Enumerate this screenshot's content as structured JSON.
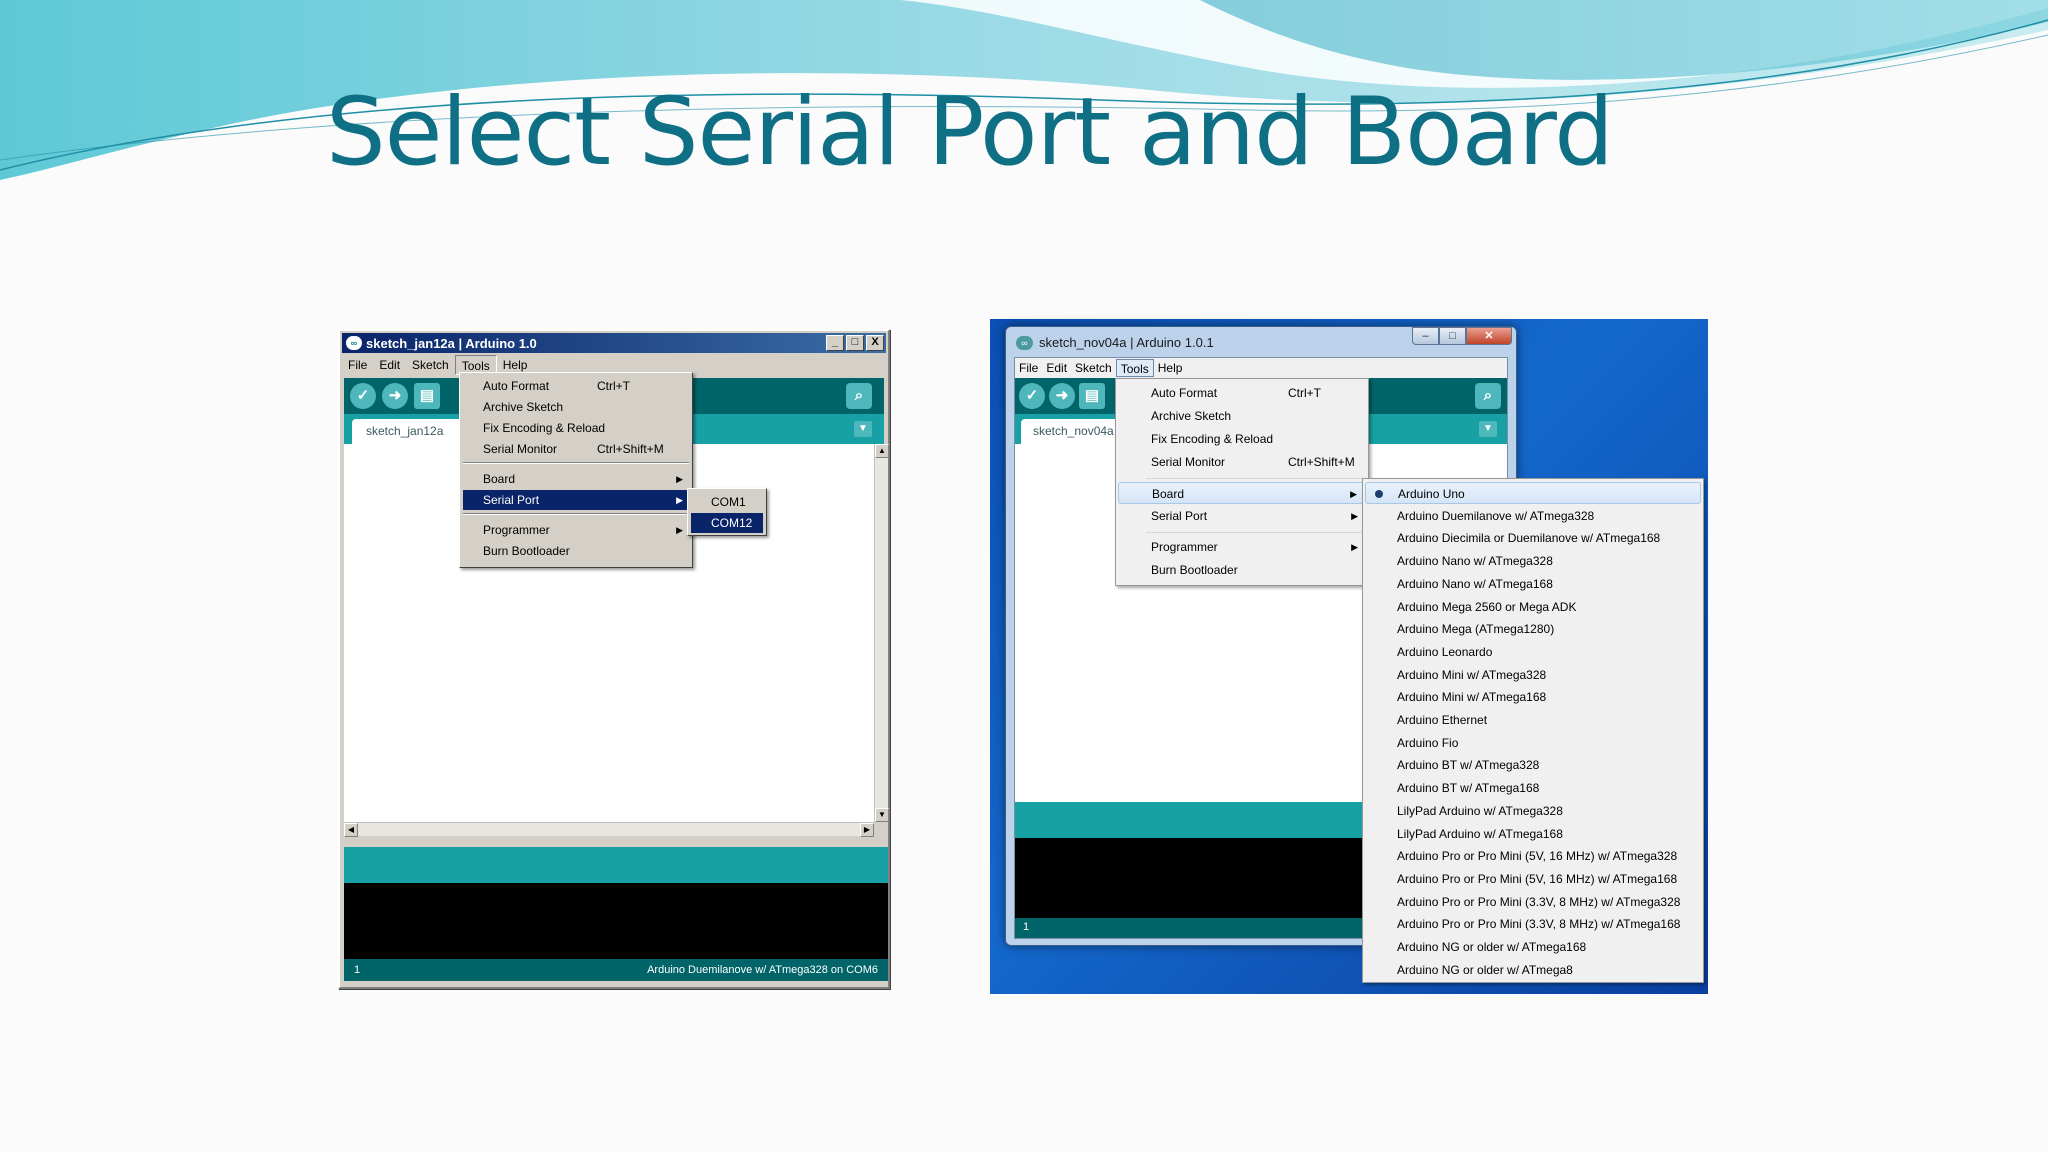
{
  "slide": {
    "title": "Select Serial Port and Board"
  },
  "left_window": {
    "title": "sketch_jan12a | Arduino 1.0",
    "window_buttons": [
      "_",
      "□",
      "X"
    ],
    "menu": [
      "File",
      "Edit",
      "Sketch",
      "Tools",
      "Help"
    ],
    "tab": "sketch_jan12a",
    "tools_menu": [
      {
        "label": "Auto Format",
        "shortcut": "Ctrl+T"
      },
      {
        "label": "Archive Sketch",
        "shortcut": ""
      },
      {
        "label": "Fix Encoding & Reload",
        "shortcut": ""
      },
      {
        "label": "Serial Monitor",
        "shortcut": "Ctrl+Shift+M"
      },
      {
        "label": "Board",
        "shortcut": ""
      },
      {
        "label": "Serial Port",
        "shortcut": ""
      },
      {
        "label": "Programmer",
        "shortcut": ""
      },
      {
        "label": "Burn Bootloader",
        "shortcut": ""
      }
    ],
    "serial_ports": [
      "COM1",
      "COM12"
    ],
    "selected_port": "COM12",
    "status_line": "1",
    "status_board": "Arduino Duemilanove w/ ATmega328 on COM6"
  },
  "right_window": {
    "title": "sketch_nov04a | Arduino 1.0.1",
    "menu": [
      "File",
      "Edit",
      "Sketch",
      "Tools",
      "Help"
    ],
    "tab": "sketch_nov04a",
    "tools_menu": [
      {
        "label": "Auto Format",
        "shortcut": "Ctrl+T"
      },
      {
        "label": "Archive Sketch",
        "shortcut": ""
      },
      {
        "label": "Fix Encoding & Reload",
        "shortcut": ""
      },
      {
        "label": "Serial Monitor",
        "shortcut": "Ctrl+Shift+M"
      },
      {
        "label": "Board",
        "shortcut": ""
      },
      {
        "label": "Serial Port",
        "shortcut": ""
      },
      {
        "label": "Programmer",
        "shortcut": ""
      },
      {
        "label": "Burn Bootloader",
        "shortcut": ""
      }
    ],
    "boards": [
      "Arduino Uno",
      "Arduino Duemilanove w/ ATmega328",
      "Arduino Diecimila or Duemilanove w/ ATmega168",
      "Arduino Nano w/ ATmega328",
      "Arduino Nano w/ ATmega168",
      "Arduino Mega 2560 or Mega ADK",
      "Arduino Mega (ATmega1280)",
      "Arduino Leonardo",
      "Arduino Mini w/ ATmega328",
      "Arduino Mini w/ ATmega168",
      "Arduino Ethernet",
      "Arduino Fio",
      "Arduino BT w/ ATmega328",
      "Arduino BT w/ ATmega168",
      "LilyPad Arduino w/ ATmega328",
      "LilyPad Arduino w/ ATmega168",
      "Arduino Pro or Pro Mini (5V, 16 MHz) w/ ATmega328",
      "Arduino Pro or Pro Mini (5V, 16 MHz) w/ ATmega168",
      "Arduino Pro or Pro Mini (3.3V, 8 MHz) w/ ATmega328",
      "Arduino Pro or Pro Mini (3.3V, 8 MHz) w/ ATmega168",
      "Arduino NG or older w/ ATmega168",
      "Arduino NG or older w/ ATmega8"
    ],
    "selected_board": "Arduino Uno",
    "status_line": "1"
  },
  "icons": {
    "verify": "check-icon",
    "upload": "arrow-right-icon",
    "new": "new-file-icon",
    "serial_monitor": "magnifier-icon",
    "submenu": "triangle-right-icon"
  },
  "colors": {
    "title": "#0f6f84",
    "arduino_dark": "#006468",
    "arduino_teal": "#17a1a5",
    "menu_highlight": "#0a246a"
  }
}
